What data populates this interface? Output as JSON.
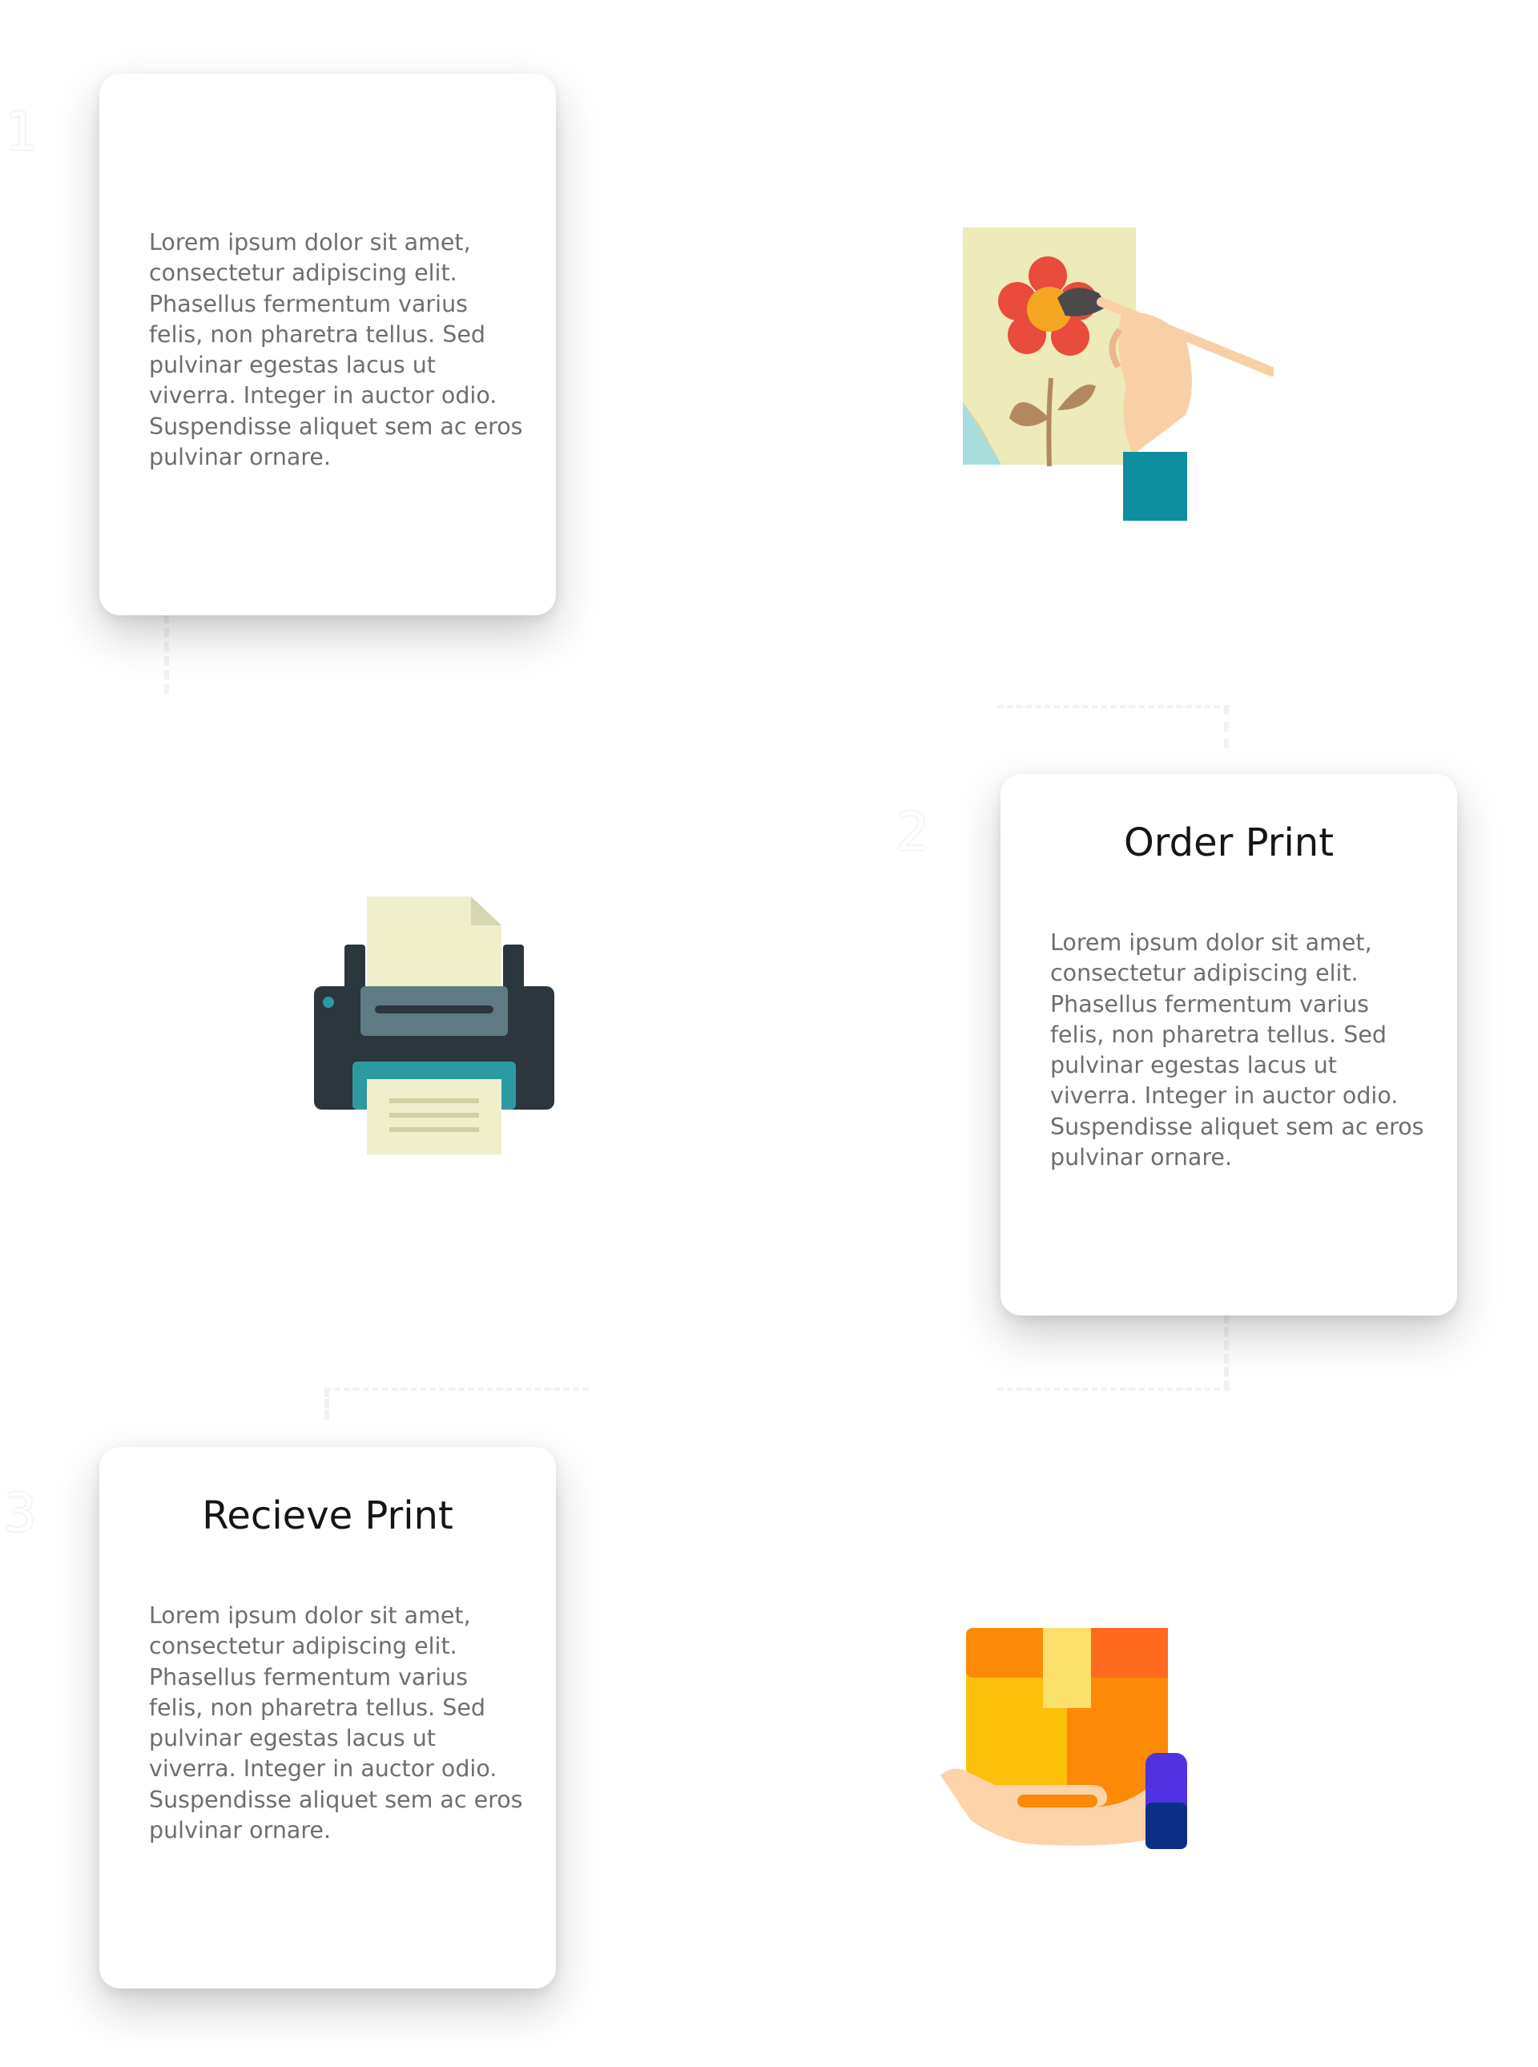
{
  "steps": [
    {
      "number": "1",
      "title": "",
      "body": "Lorem ipsum dolor sit amet, consectetur adipiscing elit. Phasellus fermentum varius felis, non pharetra tellus. Sed pulvinar egestas lacus ut viverra. Integer in auctor odio. Suspendisse aliquet sem ac eros pulvinar ornare.",
      "icon": "painting-icon"
    },
    {
      "number": "2",
      "title": "Order Print",
      "body": "Lorem ipsum dolor sit amet, consectetur adipiscing elit. Phasellus fermentum varius felis, non pharetra tellus. Sed pulvinar egestas lacus ut viverra. Integer in auctor odio. Suspendisse aliquet sem ac eros pulvinar ornare.",
      "icon": "printer-icon"
    },
    {
      "number": "3",
      "title": "Recieve Print",
      "body": "Lorem ipsum dolor sit amet, consectetur adipiscing elit. Phasellus fermentum varius felis, non pharetra tellus. Sed pulvinar egestas lacus ut viverra. Integer in auctor odio. Suspendisse aliquet sem ac eros pulvinar ornare.",
      "icon": "package-delivery-icon"
    }
  ],
  "colors": {
    "card_background": "#ffffff",
    "title_text": "#151515",
    "body_text": "#6e6e6e",
    "connector": "#f2f2f2"
  }
}
